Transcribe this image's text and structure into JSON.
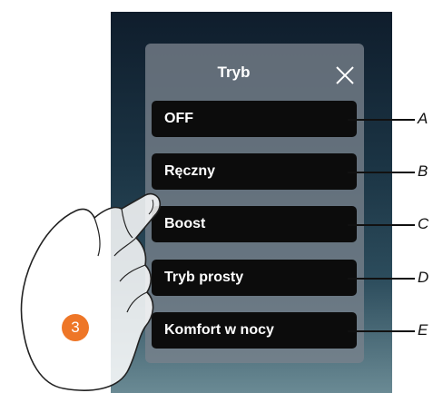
{
  "dialog": {
    "title": "Tryb",
    "close_icon": "close-icon"
  },
  "mode_options": [
    {
      "label": "OFF",
      "callout": "A"
    },
    {
      "label": "Ręczny",
      "callout": "B"
    },
    {
      "label": "Boost",
      "callout": "C"
    },
    {
      "label": "Tryb prosty",
      "callout": "D"
    },
    {
      "label": "Komfort w nocy",
      "callout": "E"
    }
  ],
  "step_badge": "3",
  "colors": {
    "step_badge": "#ee7627",
    "button_bg": "#0c0c0c",
    "panel_bg": "#78828c"
  }
}
